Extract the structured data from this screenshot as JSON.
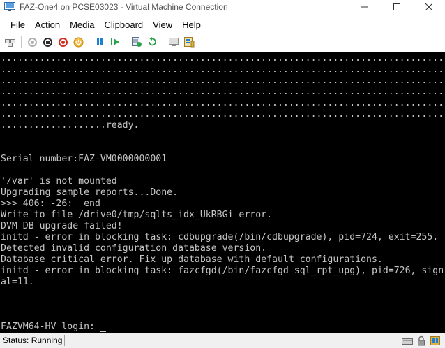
{
  "window": {
    "title": "FAZ-One4 on PCSE03023 - Virtual Machine Connection",
    "controls": {
      "minimize": "—",
      "maximize": "☐",
      "close": "✕"
    }
  },
  "menu": [
    "File",
    "Action",
    "Media",
    "Clipboard",
    "View",
    "Help"
  ],
  "toolbar": {
    "buttons": [
      "ctrl-alt-del-icon",
      "start-icon",
      "turn-off-icon",
      "shutdown-icon",
      "power-icon",
      "pause-icon",
      "resume-icon",
      "checkpoint-icon",
      "revert-icon",
      "enhanced-session-icon",
      "settings-icon"
    ],
    "colors": {
      "red": "#d52b1e",
      "orange": "#e8a020",
      "blue": "#1e7fd6",
      "green": "#2aa34a",
      "gray": "#7a7a7a"
    }
  },
  "console": {
    "lines": [
      "................................................................................",
      "................................................................................",
      "................................................................................",
      "................................................................................",
      "................................................................................",
      "................................................................................",
      "...................ready.",
      "",
      "",
      "Serial number:FAZ-VM0000000001",
      "",
      "'/var' is not mounted",
      "Upgrading sample reports...Done.",
      ">>> 406: -26:  end",
      "Write to file /drive0/tmp/sqlts_idx_UkRBGi error.",
      "DVM DB upgrade failed!",
      "initd - error in blocking task: cdbupgrade(/bin/cdbupgrade), pid=724, exit=255.",
      "Detected invalid configuration database version.",
      "Database critical error. Fix up database with default configurations.",
      "initd - error in blocking task: fazcfgd(/bin/fazcfgd sql_rpt_upg), pid=726, sign",
      "al=11.",
      "",
      "",
      "",
      "FAZVM64-HV login: "
    ],
    "text_color": "#c6c6c6",
    "background": "#000000"
  },
  "status": {
    "text": "Status: Running"
  }
}
